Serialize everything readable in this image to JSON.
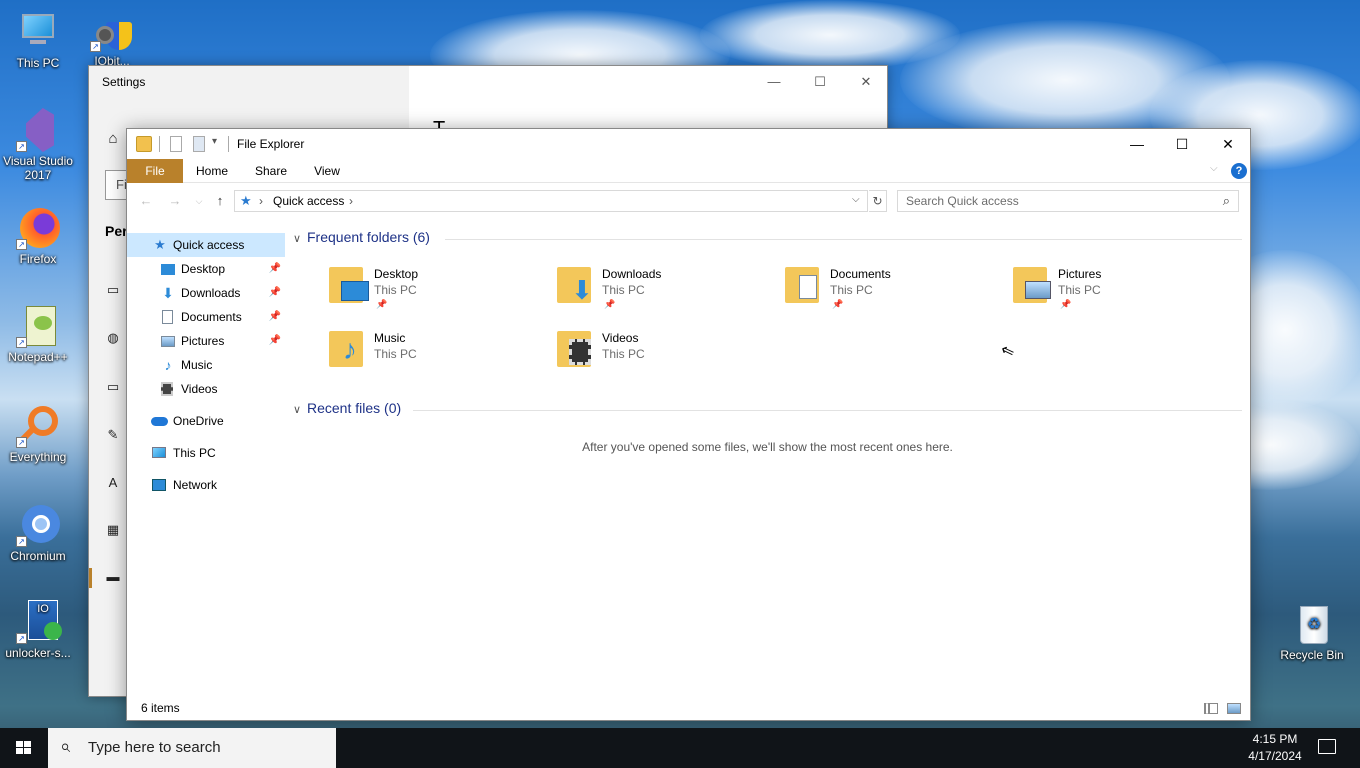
{
  "desktop": {
    "icons": [
      {
        "label": "This PC"
      },
      {
        "label": "IObit..."
      },
      {
        "label": "Visual Studio 2017"
      },
      {
        "label": "Firefox"
      },
      {
        "label": "Notepad++"
      },
      {
        "label": "Everything"
      },
      {
        "label": "Chromium"
      },
      {
        "label": "unlocker-s..."
      },
      {
        "label": "Recycle Bin"
      }
    ]
  },
  "settings": {
    "title": "Settings",
    "search_placeholder": "Fi",
    "section_label": "Per",
    "heading_fragment": "T…"
  },
  "explorer": {
    "title": "File Explorer",
    "ribbon": {
      "file": "File",
      "home": "Home",
      "share": "Share",
      "view": "View"
    },
    "address": {
      "location": "Quick access"
    },
    "search_placeholder": "Search Quick access",
    "nav": {
      "quick_access": "Quick access",
      "items": [
        {
          "label": "Desktop"
        },
        {
          "label": "Downloads"
        },
        {
          "label": "Documents"
        },
        {
          "label": "Pictures"
        },
        {
          "label": "Music"
        },
        {
          "label": "Videos"
        }
      ],
      "onedrive": "OneDrive",
      "this_pc": "This PC",
      "network": "Network"
    },
    "frequent_header": "Frequent folders (6)",
    "folders": [
      {
        "name": "Desktop",
        "location": "This PC"
      },
      {
        "name": "Downloads",
        "location": "This PC"
      },
      {
        "name": "Documents",
        "location": "This PC"
      },
      {
        "name": "Pictures",
        "location": "This PC"
      },
      {
        "name": "Music",
        "location": "This PC"
      },
      {
        "name": "Videos",
        "location": "This PC"
      }
    ],
    "recent_header": "Recent files (0)",
    "recent_empty": "After you've opened some files, we'll show the most recent ones here.",
    "status": "6 items"
  },
  "taskbar": {
    "search_placeholder": "Type here to search",
    "time": "4:15 PM",
    "date": "4/17/2024"
  }
}
